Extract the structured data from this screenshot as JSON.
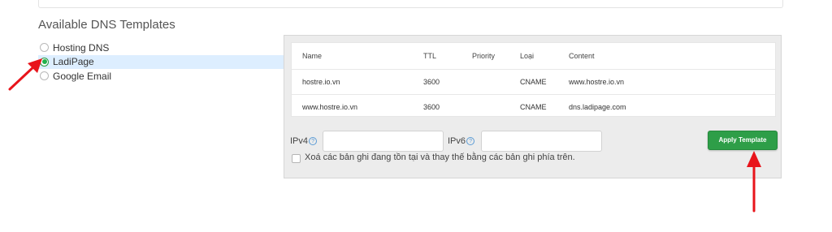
{
  "section": {
    "title": "Available DNS Templates"
  },
  "templates": [
    {
      "label": "Hosting DNS",
      "selected": false
    },
    {
      "label": "LadiPage",
      "selected": true
    },
    {
      "label": "Google Email",
      "selected": false
    }
  ],
  "records": {
    "headers": {
      "name": "Name",
      "ttl": "TTL",
      "priority": "Priority",
      "type": "Loại",
      "content": "Content"
    },
    "rows": [
      {
        "name": "hostre.io.vn",
        "ttl": "3600",
        "priority": "",
        "type": "CNAME",
        "content": "www.hostre.io.vn"
      },
      {
        "name": "www.hostre.io.vn",
        "ttl": "3600",
        "priority": "",
        "type": "CNAME",
        "content": "dns.ladipage.com"
      }
    ]
  },
  "options": {
    "ipv4_label": "IPv4",
    "ipv4_value": "",
    "ipv6_label": "IPv6",
    "ipv6_value": "",
    "help_glyph": "?",
    "replace_label": "Xoá các bản ghi đang tồn tại và thay thế bằng các bản ghi phía trên.",
    "replace_checked": false,
    "apply_button": "Apply Template"
  },
  "colors": {
    "accent": "#2e9e48",
    "radio_selected": "#22b14c",
    "selected_row_bg": "#ddeeff",
    "annotation_arrow": "#e8141b"
  },
  "icons": {
    "radio": "radio-icon",
    "help": "help-circle-icon",
    "arrow": "red-arrow-annotation"
  }
}
